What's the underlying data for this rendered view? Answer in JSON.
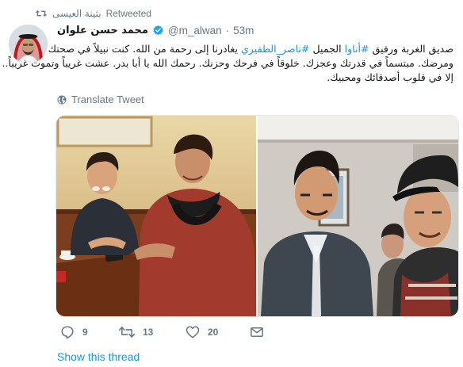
{
  "retweet_context": {
    "name": "بثينة العيسى",
    "label": "Retweeted"
  },
  "author": {
    "display_name": "محمد حسن علوان",
    "handle": "@m_alwan",
    "separator": "·",
    "time": "53m",
    "verified": true
  },
  "tweet": {
    "line1_prefix": "صديق الغربة ورفيق ",
    "hashtag1": "#أناوا",
    "line1_mid": " الجميل ",
    "hashtag2": "#ناصر_الظفيري",
    "line1_suffix": " يغادرنا إلى رحمة من الله. كنت نبيلاً في صحتك",
    "line2": "ومرضك. مبتسماً في قدرتك وعجزك. خلوقاً في فرحك وحزنك. رحمك الله يا أبا بدر. عشت غريباً وتموت غريباً..",
    "line3": "إلا في قلوب أصدقائك ومحبيك."
  },
  "translate_label": "Translate Tweet",
  "actions": {
    "reply_count": "9",
    "retweet_count": "13",
    "like_count": "20"
  },
  "show_thread_label": "Show this thread",
  "colors": {
    "link": "#1b95e0",
    "secondary_text": "#657786",
    "primary_text": "#14171a",
    "verified": "#1da1f2"
  }
}
